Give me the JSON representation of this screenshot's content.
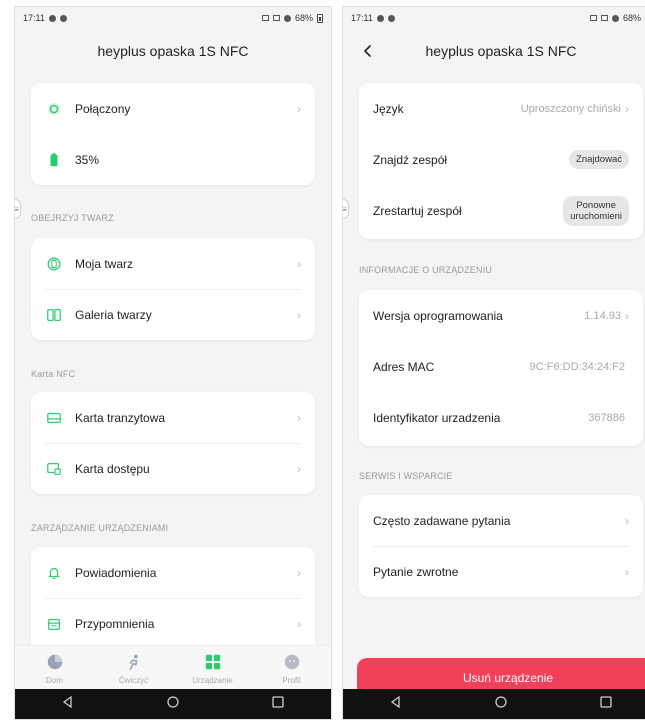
{
  "status_left": {
    "time": "17:11"
  },
  "status_right": {
    "battery_left": "68%",
    "battery_right": "68%"
  },
  "left_screen": {
    "title": "heyplus opaska 1S NFC",
    "status_card": {
      "connection": "Połączony",
      "battery": "35%"
    },
    "sections": {
      "faces": "OBEJRZYJ TWARZ",
      "nfc": "Karta NFC",
      "manage": "ZARZĄDZANIE URZĄDZENIAMI"
    },
    "faces_items": [
      "Moja twarz",
      "Galeria twarzy"
    ],
    "nfc_items": [
      "Karta tranzytowa",
      "Karta dostępu"
    ],
    "manage_items": [
      "Powiadomienia",
      "Przypomnienia"
    ],
    "tabs": [
      "Dom",
      "Ćwiczyć",
      "Urządzenie",
      "Profil"
    ]
  },
  "right_screen": {
    "title": "heyplus opaska 1S NFC",
    "settings": {
      "language_label": "Język",
      "language_value": "Uproszczony chiński",
      "find_label": "Znajdź zespół",
      "find_button": "Znajdować",
      "restart_label": "Zrestartuj zespół",
      "restart_button_line1": "Ponowne",
      "restart_button_line2": "uruchomieni"
    },
    "info_section": "INFORMACJE O URZĄDZENIU",
    "info": {
      "firmware_label": "Wersja oprogramowania",
      "firmware_value": "1.14.93",
      "mac_label": "Adres MAC",
      "mac_value": "9C:F6:DD:34:24:F2",
      "device_id_label": "Identyfikator urzadzenia",
      "device_id_value": "367886"
    },
    "support_section": "SERWIS I WSPARCIE",
    "support_items": [
      "Często zadawane pytania",
      "Pytanie zwrotne"
    ],
    "delete_button": "Usuń urządzenie"
  },
  "colors": {
    "accent_green": "#2ecc71",
    "delete_red": "#f0405a"
  }
}
